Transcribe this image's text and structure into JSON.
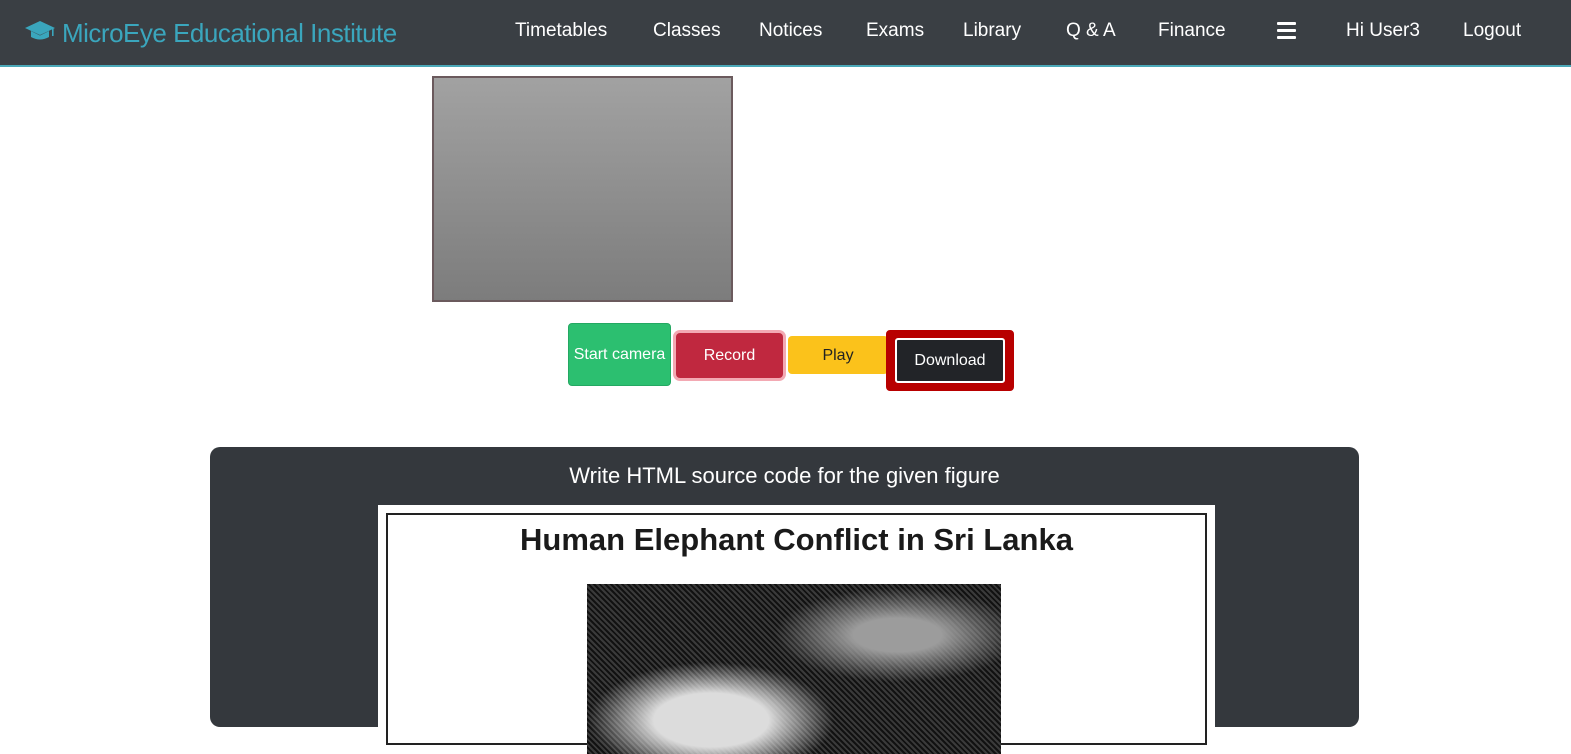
{
  "navbar": {
    "brand": "MicroEye Educational Institute",
    "brand_icon": "graduation-cap-icon",
    "items": [
      "Timetables",
      "Classes",
      "Notices",
      "Exams",
      "Library",
      "Q & A",
      "Finance"
    ],
    "menu_icon": "hamburger-menu-icon",
    "greeting": "Hi User3",
    "logout": "Logout"
  },
  "controls": {
    "start_camera": "Start camera",
    "record": "Record",
    "play": "Play",
    "download": "Download"
  },
  "task": {
    "title": "Write HTML source code for the given figure",
    "figure_title": "Human Elephant Conflict in Sri Lanka"
  },
  "colors": {
    "navbar_bg": "#3a3f44",
    "brand": "#3aa6bd",
    "start": "#2cbf70",
    "record": "#c0283f",
    "play": "#fbc21b",
    "download": "#222428",
    "highlight": "#b80000",
    "panel": "#34383d"
  }
}
